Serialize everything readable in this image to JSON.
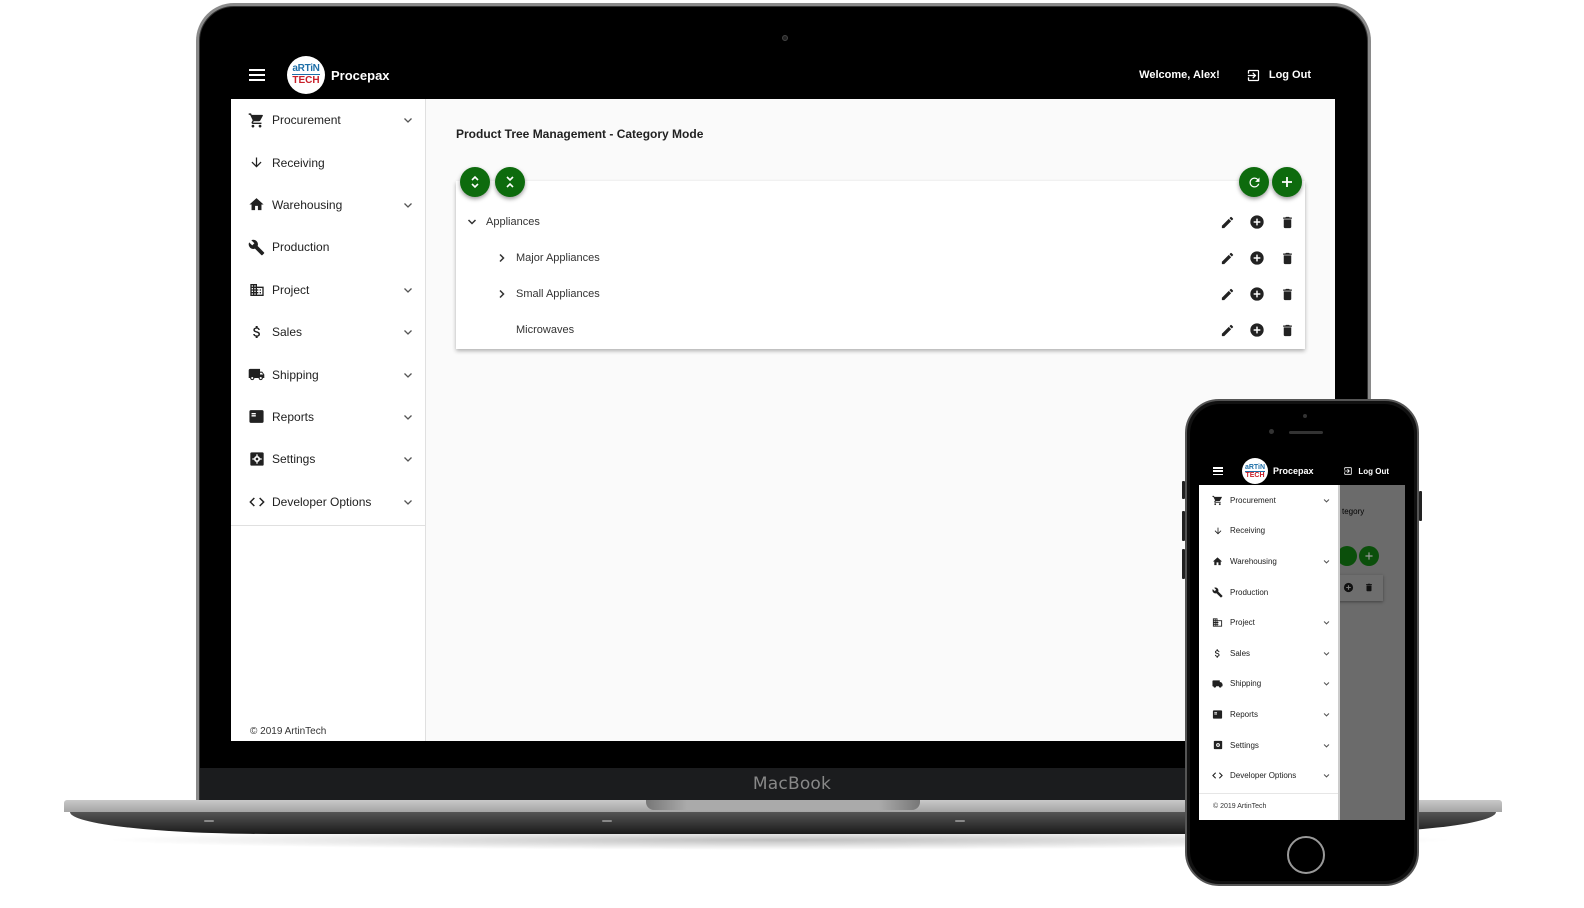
{
  "device": {
    "laptop_label": "MacBook"
  },
  "app": {
    "brand": "Procepax",
    "logo": {
      "line1": "aRTiN",
      "line2": "TECH"
    },
    "welcome": "Welcome, Alex!",
    "logout_label": "Log Out",
    "copyright": "© 2019 ArtinTech"
  },
  "sidebar": {
    "items": [
      {
        "label": "Procurement",
        "icon": "cart-icon",
        "expandable": true
      },
      {
        "label": "Receiving",
        "icon": "arrow-down-icon",
        "expandable": false
      },
      {
        "label": "Warehousing",
        "icon": "home-icon",
        "expandable": true
      },
      {
        "label": "Production",
        "icon": "wrench-icon",
        "expandable": false
      },
      {
        "label": "Project",
        "icon": "building-icon",
        "expandable": true
      },
      {
        "label": "Sales",
        "icon": "dollar-icon",
        "expandable": true
      },
      {
        "label": "Shipping",
        "icon": "truck-icon",
        "expandable": true
      },
      {
        "label": "Reports",
        "icon": "report-icon",
        "expandable": true
      },
      {
        "label": "Settings",
        "icon": "gear-icon",
        "expandable": true
      },
      {
        "label": "Developer Options",
        "icon": "code-icon",
        "expandable": true
      }
    ]
  },
  "main": {
    "title": "Product Tree Management - Category Mode",
    "toolbar": {
      "expand_all": "expand-all-icon",
      "collapse_all": "collapse-all-icon",
      "refresh": "refresh-icon",
      "add": "add-icon"
    },
    "tree": [
      {
        "label": "Appliances",
        "level": 0,
        "state": "expanded"
      },
      {
        "label": "Major Appliances",
        "level": 1,
        "state": "collapsed"
      },
      {
        "label": "Small Appliances",
        "level": 1,
        "state": "collapsed"
      },
      {
        "label": "Microwaves",
        "level": 1,
        "state": "leaf"
      }
    ],
    "row_actions": [
      "edit",
      "add-child",
      "delete"
    ]
  },
  "phone": {
    "background_title_fragment": "tegory"
  },
  "colors": {
    "topbar": "#000000",
    "fab_green": "#0d6b0d",
    "logo_blue": "#1e6fa8",
    "logo_red": "#c8202a"
  }
}
